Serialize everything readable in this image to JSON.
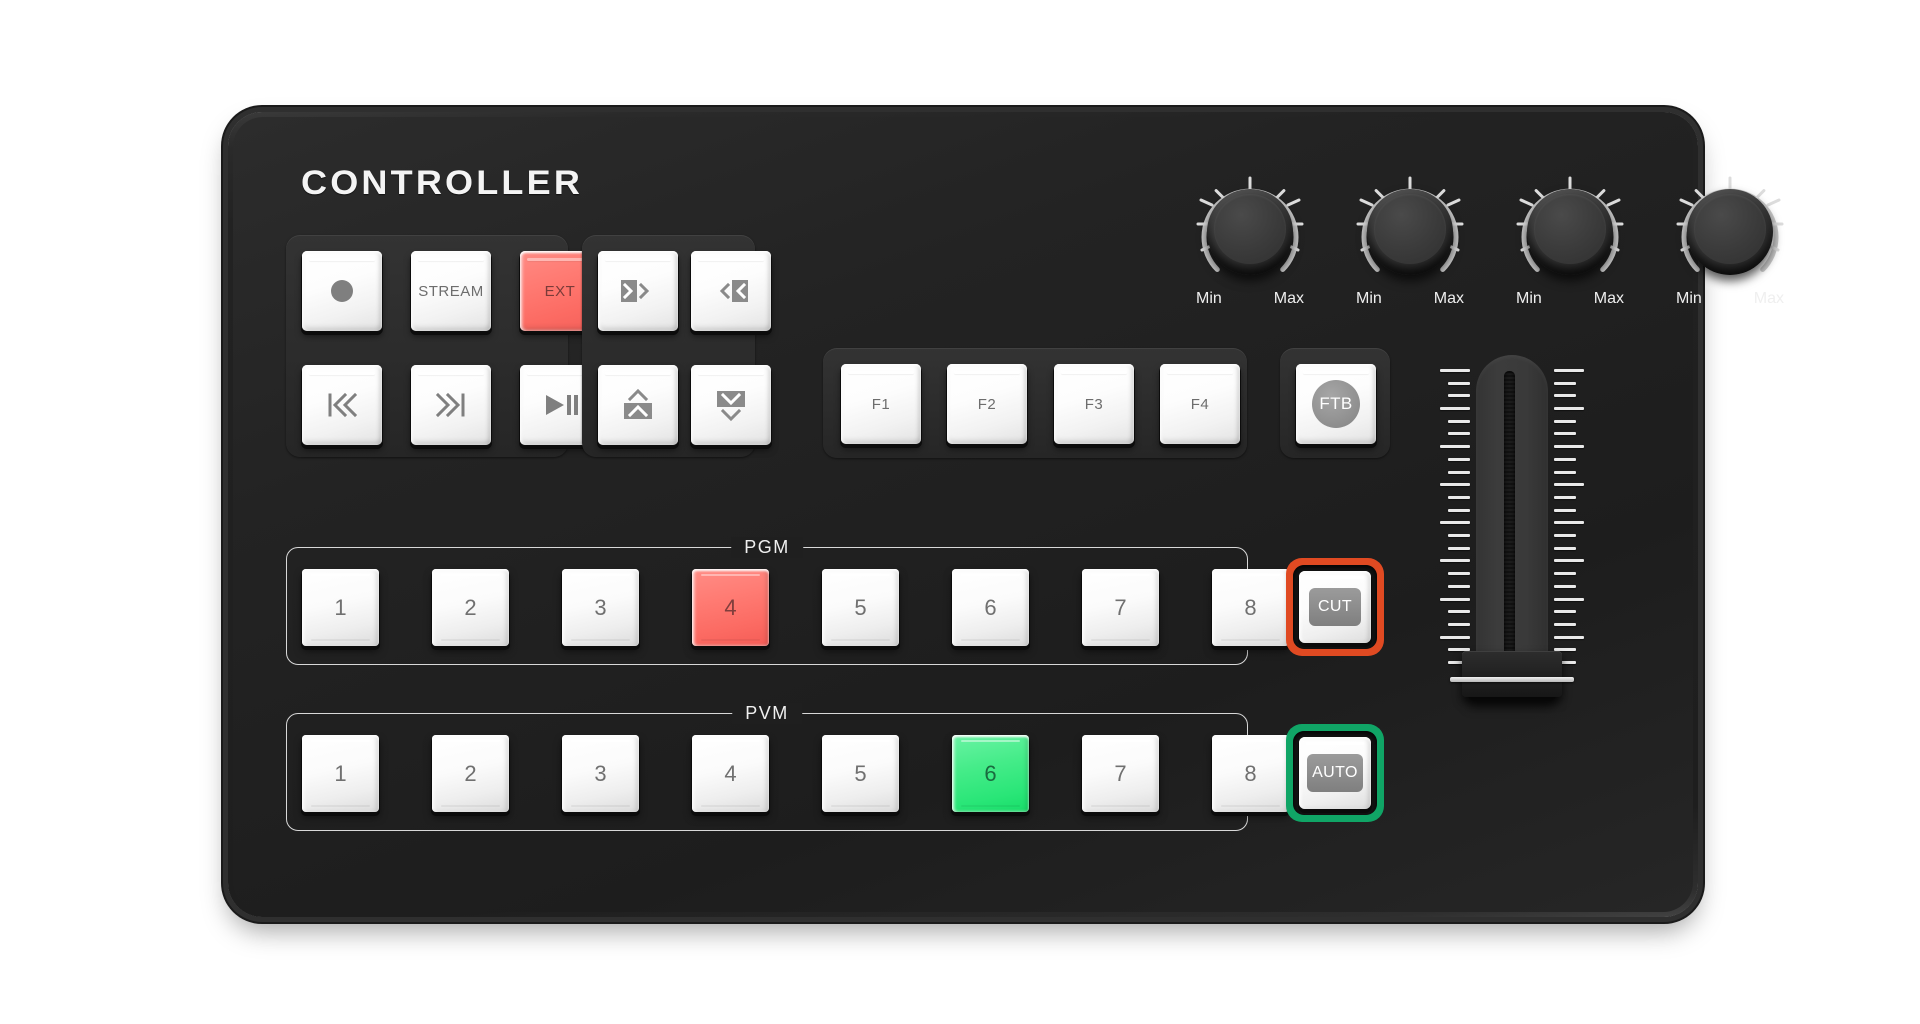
{
  "device": {
    "brand": "CONTROLLER",
    "colors": {
      "body": "#1f1f1f",
      "accent_red": "#ff7a72",
      "accent_green": "#36e27c",
      "cut_ring": "#e04a22",
      "auto_ring": "#10a566",
      "key_white": "#ffffff",
      "glyph_gray": "#7f7f7f"
    }
  },
  "transport_group": {
    "keys": [
      {
        "name": "record",
        "icon": "record-circle-icon",
        "label": "",
        "state": "off"
      },
      {
        "name": "stream",
        "icon": "",
        "label": "STREAM",
        "state": "off"
      },
      {
        "name": "ext",
        "icon": "",
        "label": "EXT",
        "state": "active-red"
      },
      {
        "name": "skip-start",
        "icon": "skip-to-start-icon",
        "label": "",
        "state": "off"
      },
      {
        "name": "fast-forward",
        "icon": "fast-forward-end-icon",
        "label": "",
        "state": "off"
      },
      {
        "name": "play-pause",
        "icon": "play-pause-icon",
        "label": "",
        "state": "off"
      }
    ]
  },
  "nav_group": {
    "keys": [
      {
        "name": "page-next",
        "icon": "next-boxed-right-icon",
        "state": "off"
      },
      {
        "name": "page-prev",
        "icon": "prev-boxed-left-icon",
        "state": "off"
      },
      {
        "name": "page-up",
        "icon": "up-boxed-icon",
        "state": "off"
      },
      {
        "name": "page-down",
        "icon": "down-boxed-icon",
        "state": "off"
      }
    ]
  },
  "function_group": {
    "keys": [
      {
        "name": "f1",
        "label": "F1"
      },
      {
        "name": "f2",
        "label": "F2"
      },
      {
        "name": "f3",
        "label": "F3"
      },
      {
        "name": "f4",
        "label": "F4"
      }
    ]
  },
  "ftb": {
    "label": "FTB",
    "name": "fade-to-black"
  },
  "knobs": [
    {
      "name": "knob-1",
      "min_label": "Min",
      "max_label": "Max",
      "ticks": 9
    },
    {
      "name": "knob-2",
      "min_label": "Min",
      "max_label": "Max",
      "ticks": 9
    },
    {
      "name": "knob-3",
      "min_label": "Min",
      "max_label": "Max",
      "ticks": 9
    },
    {
      "name": "knob-4",
      "min_label": "Min",
      "max_label": "Max",
      "ticks": 9
    }
  ],
  "pgm_bus": {
    "legend": "PGM",
    "buttons": [
      {
        "label": "1",
        "state": "off"
      },
      {
        "label": "2",
        "state": "off"
      },
      {
        "label": "3",
        "state": "off"
      },
      {
        "label": "4",
        "state": "active-red"
      },
      {
        "label": "5",
        "state": "off"
      },
      {
        "label": "6",
        "state": "off"
      },
      {
        "label": "7",
        "state": "off"
      },
      {
        "label": "8",
        "state": "off"
      }
    ],
    "active_index": 4
  },
  "pvm_bus": {
    "legend": "PVM",
    "buttons": [
      {
        "label": "1",
        "state": "off"
      },
      {
        "label": "2",
        "state": "off"
      },
      {
        "label": "3",
        "state": "off"
      },
      {
        "label": "4",
        "state": "off"
      },
      {
        "label": "5",
        "state": "off"
      },
      {
        "label": "6",
        "state": "active-green"
      },
      {
        "label": "7",
        "state": "off"
      },
      {
        "label": "8",
        "state": "off"
      }
    ],
    "active_index": 6
  },
  "transition": {
    "cut_label": "CUT",
    "auto_label": "AUTO"
  },
  "tbar": {
    "name": "t-bar-fader",
    "tick_count": 24,
    "handle_position": "bottom"
  }
}
